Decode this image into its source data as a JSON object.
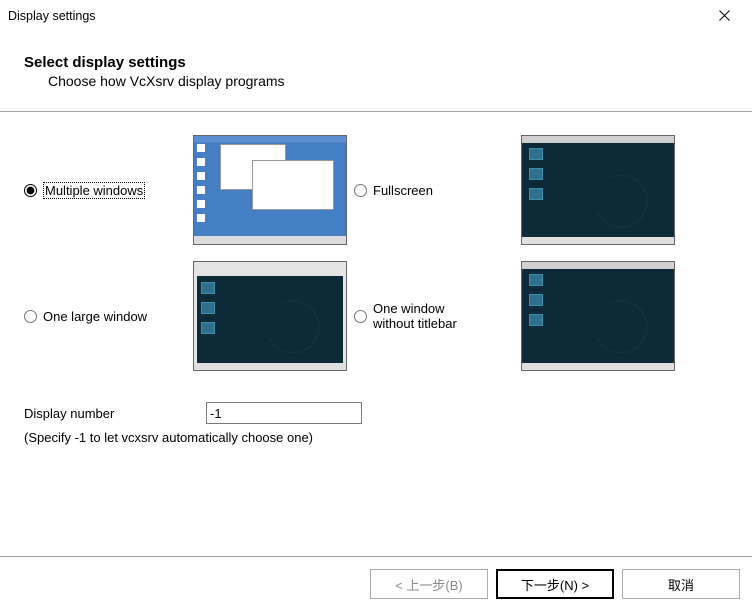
{
  "window": {
    "title": "Display settings"
  },
  "header": {
    "title": "Select display settings",
    "subtitle": "Choose how VcXsrv display programs"
  },
  "options": {
    "multiple_windows": "Multiple windows",
    "fullscreen": "Fullscreen",
    "one_large_window": "One large window",
    "one_window_no_titlebar": "One window\nwithout titlebar"
  },
  "selected_option": "multiple_windows",
  "display_number": {
    "label": "Display number",
    "value": "-1",
    "note": "(Specify -1 to let vcxsrv automatically choose one)"
  },
  "buttons": {
    "back": "< 上一步(B)",
    "next": "下一步(N) >",
    "cancel": "取消"
  }
}
